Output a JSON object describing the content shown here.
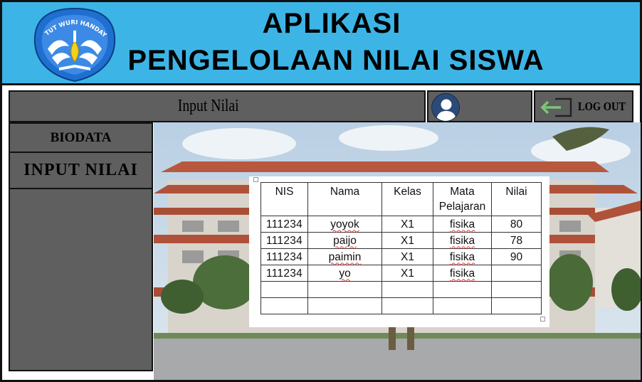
{
  "header": {
    "title_line1": "APLIKASI",
    "title_line2": "PENGELOLAAN NILAI SISWA",
    "logo_icon": "tut-wuri-handayani-logo",
    "logo_text": "TUT WURI HANDAYANI",
    "background_color": "#3cb5e6"
  },
  "topbar": {
    "page_title": "Input Nilai",
    "avatar_icon": "user-avatar-icon",
    "logout_icon": "logout-arrow-icon",
    "logout_label": "LOG OUT",
    "bar_color": "#5f5f5f"
  },
  "sidebar": {
    "items": [
      {
        "label": "BIODATA"
      },
      {
        "label": "INPUT NILAI"
      }
    ]
  },
  "table": {
    "headers": [
      "NIS",
      "Nama",
      "Kelas",
      "Mata\nPelajaran",
      "Nilai"
    ],
    "header_mata": "Mata",
    "header_pelajaran": "Pelajaran",
    "rows": [
      {
        "nis": "111234",
        "nama": "yoyok",
        "kelas": "X1",
        "mapel": "fisika",
        "nilai": "80"
      },
      {
        "nis": "111234",
        "nama": "paijo",
        "kelas": "X1",
        "mapel": "fisika",
        "nilai": "78"
      },
      {
        "nis": "111234",
        "nama": "paimin",
        "kelas": "X1",
        "mapel": "fisika",
        "nilai": "90"
      },
      {
        "nis": "111234",
        "nama": "yo",
        "kelas": "X1",
        "mapel": "fisika",
        "nilai": ""
      }
    ],
    "empty_rows": 2
  }
}
